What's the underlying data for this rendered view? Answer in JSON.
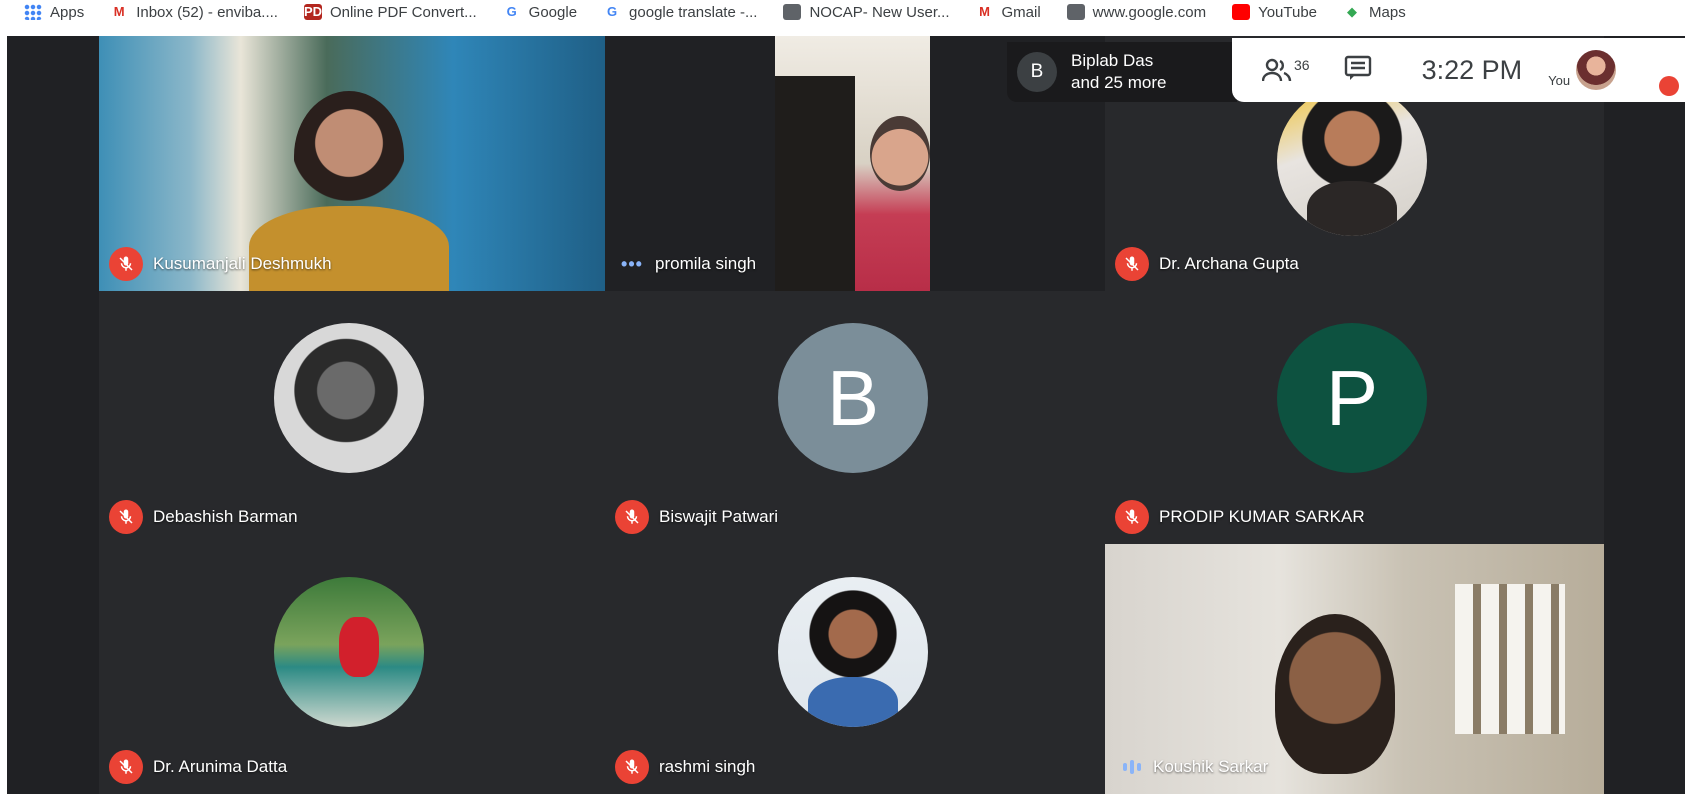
{
  "bookmarks": [
    {
      "label": "Apps",
      "icon": "apps-icon"
    },
    {
      "label": "Inbox (52) - enviba....",
      "icon": "gmail-icon"
    },
    {
      "label": "Online PDF Convert...",
      "icon": "pdf-icon"
    },
    {
      "label": "Google",
      "icon": "google-icon"
    },
    {
      "label": "google translate -...",
      "icon": "google-icon"
    },
    {
      "label": "NOCAP- New User...",
      "icon": "globe-icon"
    },
    {
      "label": "Gmail",
      "icon": "gmail-icon"
    },
    {
      "label": "www.google.com",
      "icon": "globe-icon"
    },
    {
      "label": "YouTube",
      "icon": "youtube-icon"
    },
    {
      "label": "Maps",
      "icon": "maps-icon"
    }
  ],
  "presenting": {
    "avatar_letter": "B",
    "line1": "Biplab Das",
    "line2": "and 25 more"
  },
  "topbar": {
    "people_count": "36",
    "time": "3:22 PM",
    "you_label": "You"
  },
  "participants": {
    "kusumanjali": {
      "name": "Kusumanjali Deshmukh"
    },
    "promila": {
      "name": "promila singh"
    },
    "archana": {
      "name": "Dr. Archana Gupta"
    },
    "debashish": {
      "name": "Debashish Barman"
    },
    "biswajit": {
      "name": "Biswajit Patwari",
      "letter": "B"
    },
    "prodip": {
      "name": "PRODIP KUMAR SARKAR",
      "letter": "P"
    },
    "arunima": {
      "name": "Dr. Arunima Datta"
    },
    "rashmi": {
      "name": "rashmi singh"
    },
    "koushik": {
      "name": "Koushik Sarkar"
    }
  },
  "colors": {
    "stage_bg": "#202124",
    "mute_red": "#ea4335",
    "avatar_b": "#7b8e99",
    "avatar_p": "#0d5240"
  }
}
